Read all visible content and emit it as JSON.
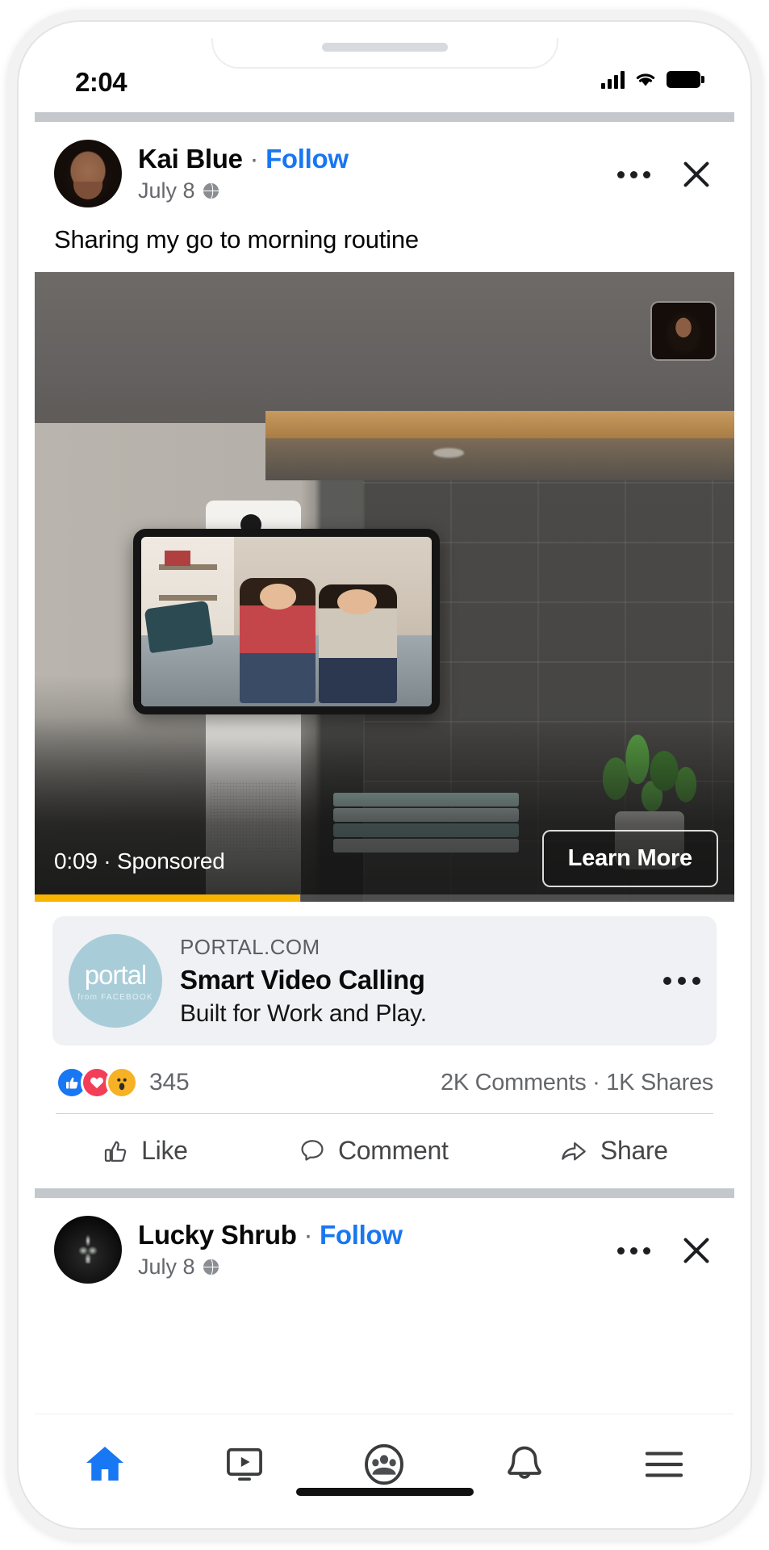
{
  "status_bar": {
    "time": "2:04",
    "signal_icon": "cellular-signal-icon",
    "wifi_icon": "wifi-icon",
    "battery_icon": "battery-full-icon"
  },
  "posts": [
    {
      "author": "Kai Blue",
      "separator": " · ",
      "follow_label": "Follow",
      "date": "July 8",
      "audience_icon": "globe-public-icon",
      "menu_icon": "more-options-icon",
      "close_icon": "close-icon",
      "body_text": "Sharing my go to morning routine",
      "video": {
        "duration_label": "0:09",
        "sponsored_label": "Sponsored",
        "meta_line": "0:09 · Sponsored",
        "cta_label": "Learn More",
        "progress_percent": 38,
        "progress_color": "#f7b500"
      },
      "link_card": {
        "domain": "PORTAL.COM",
        "title": "Smart Video Calling",
        "subtitle": "Built for Work and Play.",
        "logo_text": "portal",
        "logo_subtext": "from FACEBOOK",
        "logo_color": "#a8cdd8",
        "menu_icon": "more-options-icon"
      },
      "engagement": {
        "reaction_icons": [
          "like-reaction-icon",
          "love-reaction-icon",
          "wow-reaction-icon"
        ],
        "reaction_count": "345",
        "comments_shares": "2K Comments · 1K Shares"
      },
      "actions": [
        {
          "label": "Like",
          "icon": "thumbs-up-icon"
        },
        {
          "label": "Comment",
          "icon": "comment-bubble-icon"
        },
        {
          "label": "Share",
          "icon": "share-arrow-icon"
        }
      ]
    },
    {
      "author": "Lucky Shrub",
      "separator": " · ",
      "follow_label": "Follow",
      "date": "July 8",
      "audience_icon": "globe-public-icon",
      "menu_icon": "more-options-icon",
      "close_icon": "close-icon"
    }
  ],
  "tabbar": {
    "items": [
      {
        "name": "home",
        "icon": "home-icon",
        "active": true
      },
      {
        "name": "watch",
        "icon": "watch-video-icon",
        "active": false
      },
      {
        "name": "groups",
        "icon": "groups-icon",
        "active": false
      },
      {
        "name": "notifications",
        "icon": "bell-icon",
        "active": false
      },
      {
        "name": "menu",
        "icon": "hamburger-menu-icon",
        "active": false
      }
    ],
    "active_color": "#1877f2",
    "inactive_color": "#3a3b3c"
  },
  "colors": {
    "facebook_blue": "#1877f2",
    "text_primary": "#050505",
    "text_secondary": "#65676b",
    "card_bg": "#eff1f4",
    "feed_gap": "#c4c8cd"
  }
}
